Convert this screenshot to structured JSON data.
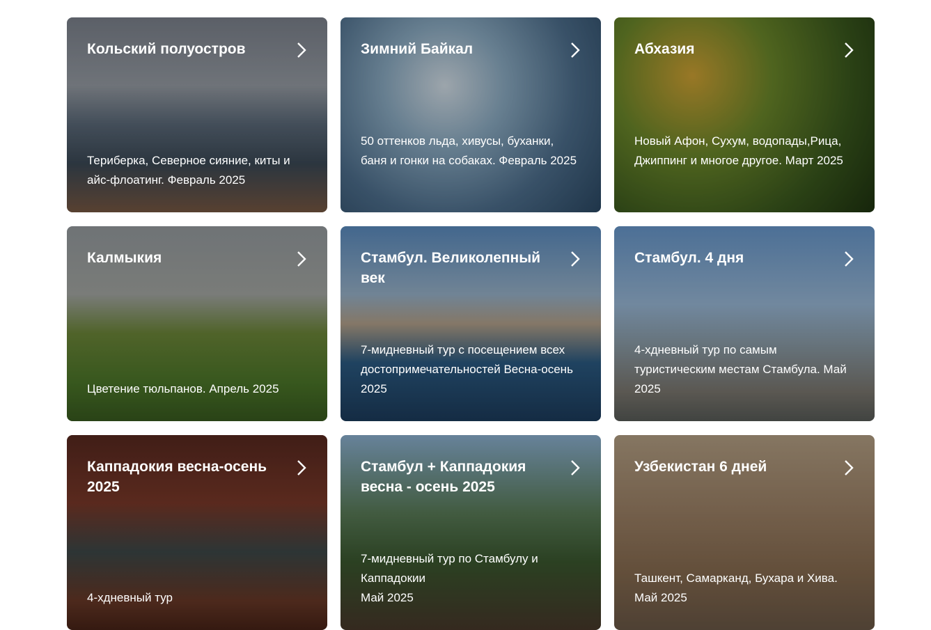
{
  "tours": [
    {
      "title": "Кольский полуостров",
      "desc": "Териберка, Северное сияние, киты и айс-флоатинг. Февраль 2025"
    },
    {
      "title": "Зимний Байкал",
      "desc": "50 оттенков льда, хивусы, буханки, баня и гонки на собаках. Февраль 2025"
    },
    {
      "title": "Абхазия",
      "desc": "Новый Афон, Сухум, водопады,Рица, Джиппинг и многое другое. Март 2025"
    },
    {
      "title": "Калмыкия",
      "desc": "Цветение тюльпанов. Апрель 2025"
    },
    {
      "title": "Стамбул. Великолепный век",
      "desc": "7-мидневный тур с посещением всех достопримечательностей Весна-осень 2025"
    },
    {
      "title": "Стамбул. 4 дня",
      "desc": "4-хдневный тур по самым туристическим местам Стамбула. Май 2025"
    },
    {
      "title": "Каппадокия весна-осень 2025",
      "desc": "4-хдневный тур"
    },
    {
      "title": "Стамбул + Каппадокия весна - осень 2025",
      "desc": "7-мидневный тур по Стамбулу и Каппадокии\nМай 2025"
    },
    {
      "title": "Узбекистан 6 дней",
      "desc": "Ташкент, Самарканд, Бухара и Хива.\nМай 2025"
    }
  ]
}
